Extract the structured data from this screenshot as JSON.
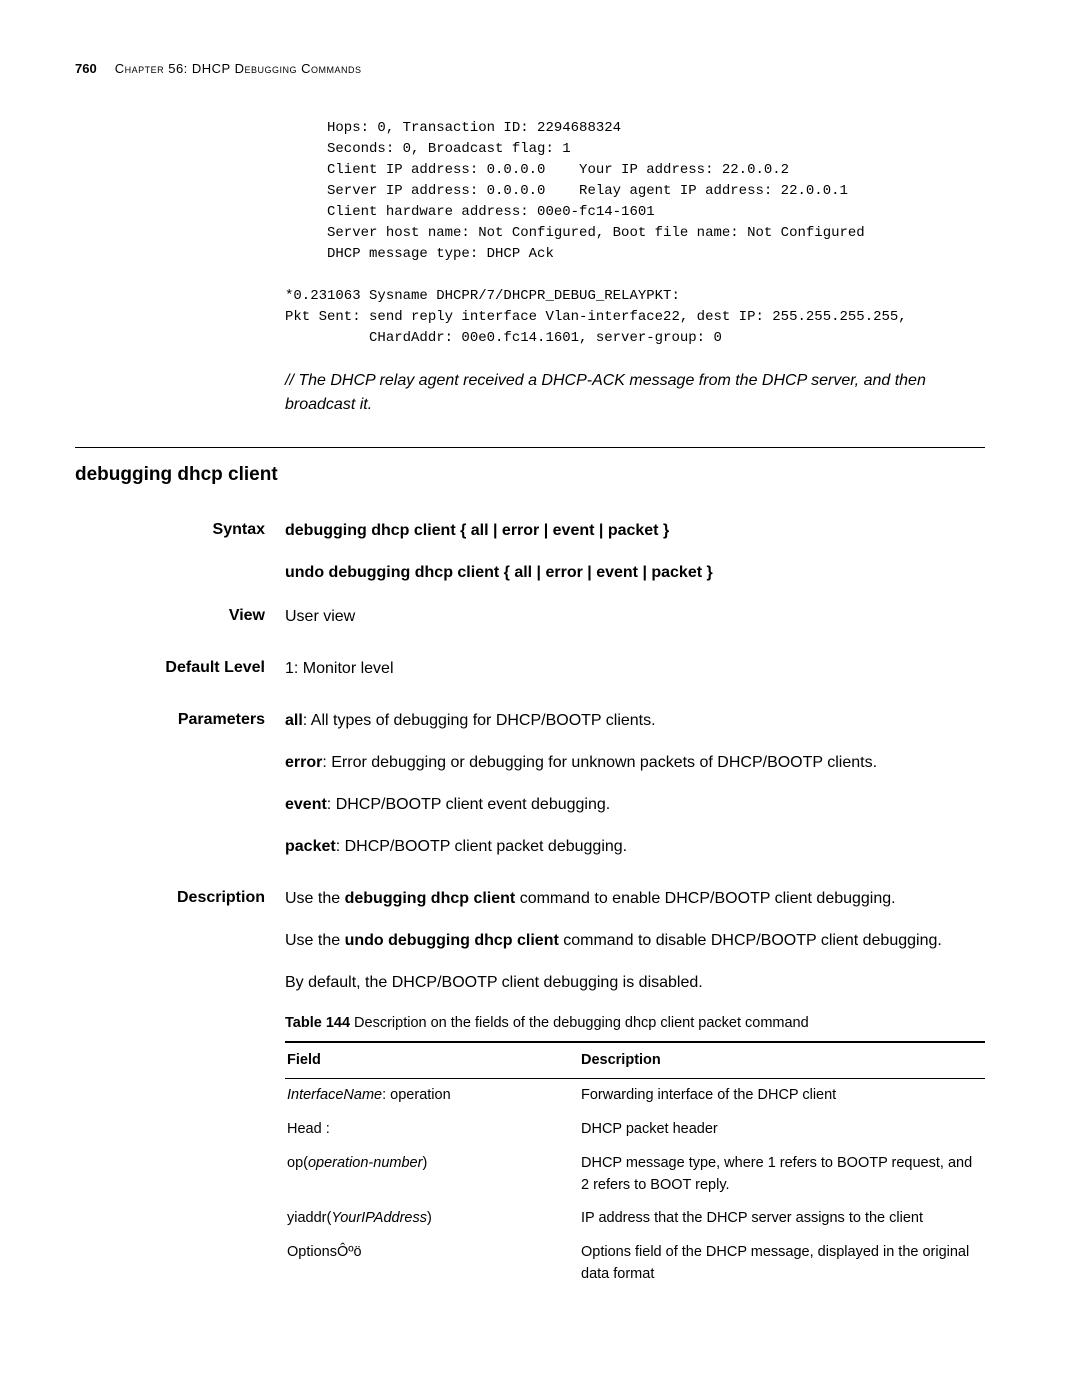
{
  "header": {
    "page_number": "760",
    "chapter_label": "Chapter 56: DHCP Debugging Commands"
  },
  "code_block": "     Hops: 0, Transaction ID: 2294688324\n     Seconds: 0, Broadcast flag: 1\n     Client IP address: 0.0.0.0    Your IP address: 22.0.0.2\n     Server IP address: 0.0.0.0    Relay agent IP address: 22.0.0.1\n     Client hardware address: 00e0-fc14-1601\n     Server host name: Not Configured, Boot file name: Not Configured\n     DHCP message type: DHCP Ack\n\n*0.231063 Sysname DHCPR/7/DHCPR_DEBUG_RELAYPKT:\nPkt Sent: send reply interface Vlan-interface22, dest IP: 255.255.255.255,\n          CHardAddr: 00e0.fc14.1601, server-group: 0",
  "comment": "// The DHCP relay agent received a DHCP-ACK message from the DHCP server, and then broadcast it.",
  "section_title": "debugging dhcp client",
  "syntax": {
    "label": "Syntax",
    "line1_cmd": "debugging dhcp client",
    "line1_opts": " { all | error | event | packet }",
    "line2_cmd": "undo debugging dhcp client",
    "line2_opts": " { all | error | event | packet }"
  },
  "view": {
    "label": "View",
    "text": "User view"
  },
  "default_level": {
    "label": "Default Level",
    "text": "1: Monitor level"
  },
  "parameters": {
    "label": "Parameters",
    "items": [
      {
        "term": "all",
        "text": ": All types of debugging for DHCP/BOOTP clients."
      },
      {
        "term": "error",
        "text": ": Error debugging or debugging for unknown packets of DHCP/BOOTP clients."
      },
      {
        "term": "event",
        "text": ": DHCP/BOOTP client event debugging."
      },
      {
        "term": "packet",
        "text": ": DHCP/BOOTP client packet debugging."
      }
    ]
  },
  "description": {
    "label": "Description",
    "p1_pre": "Use the ",
    "p1_bold": "debugging dhcp client",
    "p1_post": " command to enable DHCP/BOOTP client debugging.",
    "p2_pre": "Use the ",
    "p2_bold": "undo debugging dhcp client",
    "p2_post": " command to disable DHCP/BOOTP client debugging.",
    "p3": "By default, the DHCP/BOOTP client debugging is disabled.",
    "table_caption_bold": "Table 144",
    "table_caption_text": "   Description on the fields of the debugging dhcp client packet command",
    "table": {
      "headers": [
        "Field",
        "Description"
      ],
      "rows": [
        {
          "f_ital": "InterfaceName",
          "f_plain": ": operation",
          "d": "Forwarding interface of the DHCP client"
        },
        {
          "f_plain_only": "Head :",
          "d": "DHCP packet header"
        },
        {
          "f_pre": "op(",
          "f_ital": "operation-number",
          "f_post": ")",
          "d": "DHCP message type, where 1 refers to BOOTP request, and 2 refers to BOOT reply."
        },
        {
          "f_pre": "yiaddr(",
          "f_ital": "YourIPAddress",
          "f_post": ")",
          "d": "IP address that the DHCP server assigns to the client"
        },
        {
          "f_plain_only": "OptionsÔºö",
          "d": "Options field of the DHCP message, displayed in the original data format"
        }
      ]
    }
  }
}
